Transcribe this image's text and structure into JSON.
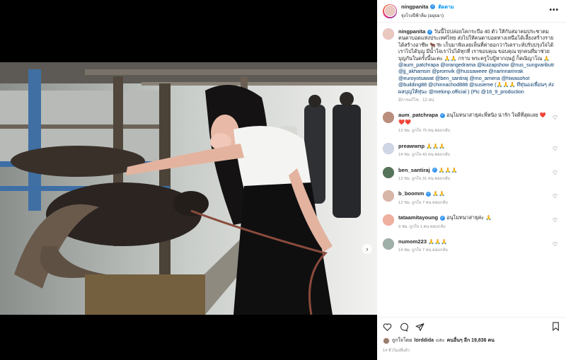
{
  "post": {
    "username": "ningpanita",
    "follow_label": "ติดตาม",
    "location": "จุ่งโรงปีฟ้าลิ่ม (อยุธยา)",
    "more_label": "•••",
    "verified_mark": "✓",
    "caption_prefix": "วันนี้ไปปล่อยโคกระบือ 40 ตัว ให้กับสมาคมประชาคมคนตาบอดแห่งประเทศไทย ส่งไปให้คนตาบอดทางเหนือได้เลี้ยงสร้างรายได้สร้างอาชีพ 🐂🐃 เก็บมาฟังเลยเห็นที่ค่ายอกว่าวิเคราะห์ปรับปรุงใจได้เราไปได้บุญ มีน้ำใจเราไปได้ทุกที่ เราขอบคุณ ขอบคุณ ทุกคนที่มาช่วยบุญกันในครั้งนี้นะคะ 🙏🙏 กราบ พระครูโบปู้หากฤษฎ์ ก็คณิญาโณ 🙏",
    "caption_mentions": "@aum_patchrapa @orangedrama @kuizapshow @nus_sungvaributr @jj_akhamsiri @promvik @hussaweee @narinnarinrak @euroyotsawat @ben_santiraj @mo_amena @hiwasohot @building88 @chinnachod888 @susieme (🙏🙏🙏 ทีทุ่นองเพื่อนๆ ส่งผลบุญให้ทุ่นะ @melonp.official ) (Pic @16_9_production",
    "caption_meta": "มีการแก้ไข · 12 สป."
  },
  "comments": [
    {
      "username": "aum_patchrapa",
      "verified": true,
      "text": "อนุโมทนาสาธุค่ะพี่หนิง น่ารัก ใจดีที่สุดเลย ❤️❤️❤️",
      "meta": "13 ชม.   ถูกใจ 75 คน   ตอบกลับ"
    },
    {
      "username": "preawwnp",
      "verified": false,
      "text": "🙏🙏🙏",
      "meta": "14 ชม.   ถูกใจ 43 คน   ตอบกลับ"
    },
    {
      "username": "ben_santiraj",
      "verified": true,
      "text": "🙏🙏🙏",
      "meta": "13 ชม.   ถูกใจ 31 คน   ตอบกลับ"
    },
    {
      "username": "b_boomm",
      "verified": true,
      "text": "🙏🙏",
      "meta": "12 ชม.   ถูกใจ 7 คน   ตอบกลับ"
    },
    {
      "username": "tataamitayoung",
      "verified": true,
      "text": "อนุโมทนาสาธุค่ะ 🙏",
      "meta": "9 ชม.   ถูกใจ 1 คน   ตอบกลับ"
    },
    {
      "username": "numom223",
      "verified": false,
      "text": "🙏🙏🙏",
      "meta": "14 ชม.   ถูกใจ 7 คน   ตอบกลับ"
    }
  ],
  "likes": {
    "prefix": "ถูกใจโดย",
    "user": "lorddida",
    "middle": "และ",
    "others": "คนอื่นๆ อีก 19,836 คน"
  },
  "timestamp": "14 ชั่วโมงที่แล้ว",
  "carousel": {
    "count": 11,
    "active": 0,
    "next_arrow": "›"
  },
  "colors": {
    "link": "#00376b",
    "accent": "#0095f6",
    "verified": "#3897f0",
    "heart": "#ed4956"
  }
}
